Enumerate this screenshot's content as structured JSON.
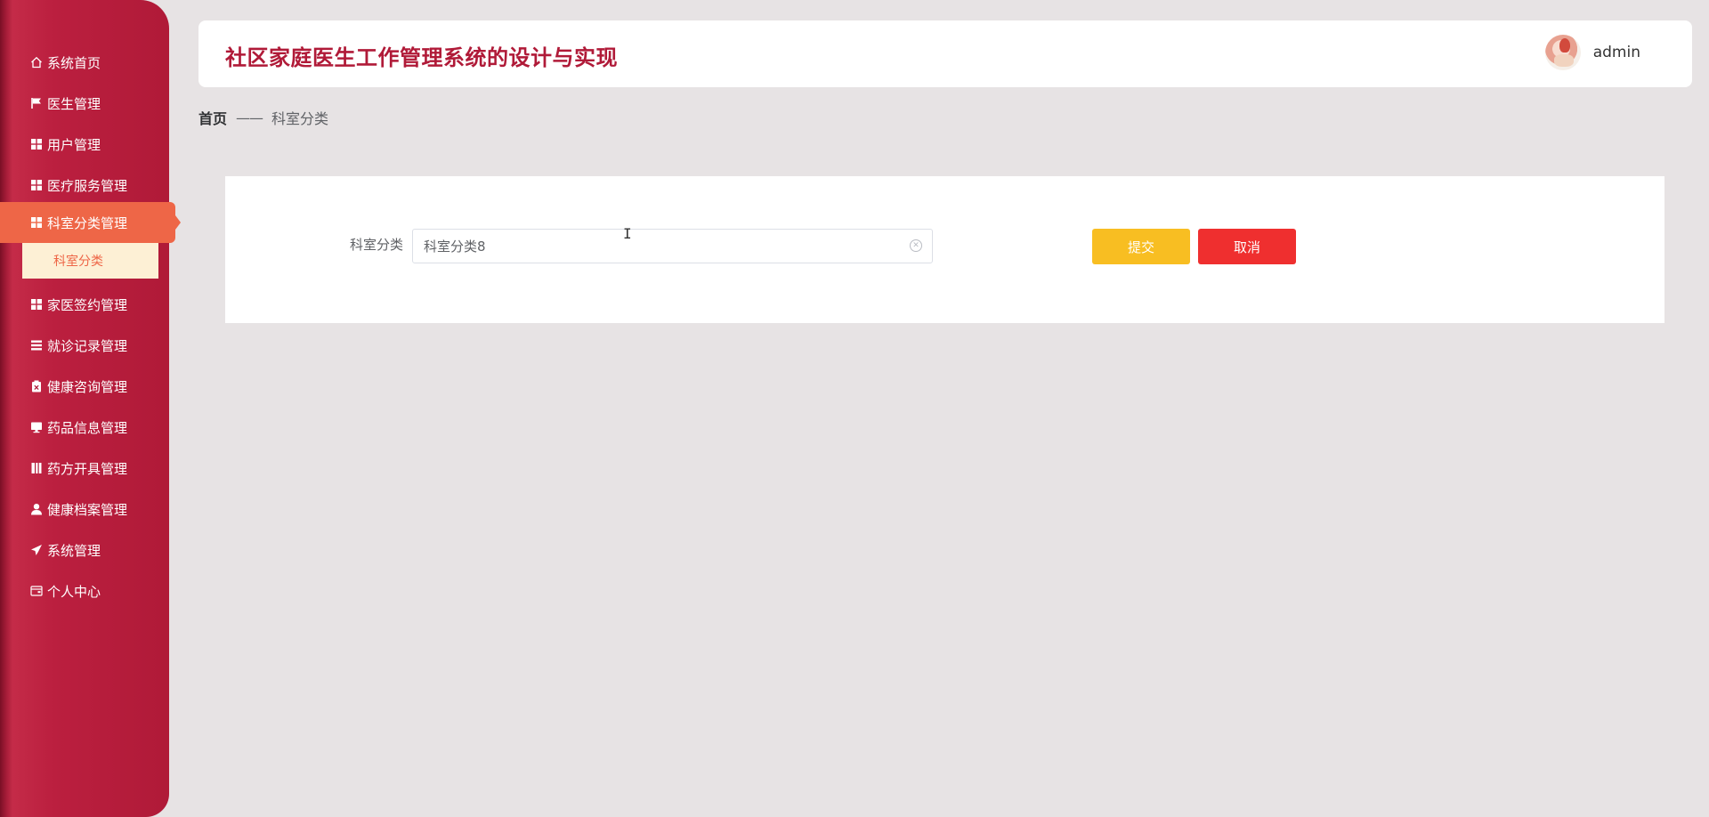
{
  "sidebar": {
    "items": [
      {
        "label": "系统首页",
        "icon": "home-icon"
      },
      {
        "label": "医生管理",
        "icon": "flag-icon"
      },
      {
        "label": "用户管理",
        "icon": "grid-icon"
      },
      {
        "label": "医疗服务管理",
        "icon": "grid-icon"
      },
      {
        "label": "科室分类管理",
        "icon": "grid-icon",
        "active": true
      },
      {
        "label": "家医签约管理",
        "icon": "grid-icon"
      },
      {
        "label": "就诊记录管理",
        "icon": "list-icon"
      },
      {
        "label": "健康咨询管理",
        "icon": "clipboard-icon"
      },
      {
        "label": "药品信息管理",
        "icon": "monitor-icon"
      },
      {
        "label": "药方开具管理",
        "icon": "book-icon"
      },
      {
        "label": "健康档案管理",
        "icon": "user-icon"
      },
      {
        "label": "系统管理",
        "icon": "send-icon"
      },
      {
        "label": "个人中心",
        "icon": "wallet-icon"
      }
    ],
    "submenu": {
      "label": "科室分类"
    }
  },
  "header": {
    "title": "社区家庭医生工作管理系统的设计与实现",
    "username": "admin"
  },
  "breadcrumb": {
    "home": "首页",
    "separator": "——",
    "current": "科室分类"
  },
  "form": {
    "label": "科室分类",
    "value": "科室分类8",
    "submit_label": "提交",
    "cancel_label": "取消"
  },
  "colors": {
    "brand": "#b01a38",
    "active_menu": "#ee6647",
    "submit": "#f8be22",
    "cancel": "#ef2f2f"
  }
}
